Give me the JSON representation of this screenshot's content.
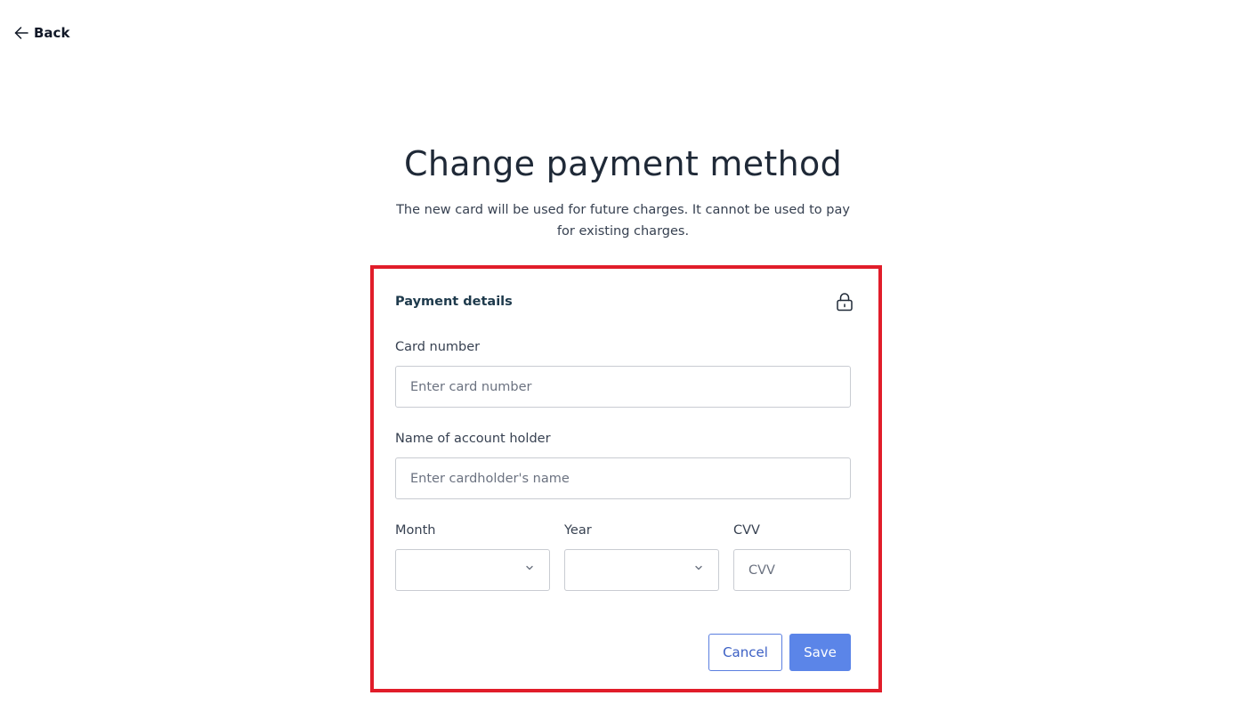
{
  "nav": {
    "back_label": "Back",
    "back_icon": "arrow-left-icon"
  },
  "header": {
    "title": "Change payment method",
    "subtitle": "The new card will be used for future charges. It cannot be used to pay for existing charges."
  },
  "payment_form": {
    "title": "Payment details",
    "lock_icon": "lock-icon",
    "card_number": {
      "label": "Card number",
      "value": "",
      "placeholder": "Enter card number"
    },
    "account_holder": {
      "label": "Name of account holder",
      "value": "",
      "placeholder": "Enter cardholder's name"
    },
    "month": {
      "label": "Month",
      "selected": ""
    },
    "year": {
      "label": "Year",
      "selected": ""
    },
    "cvv": {
      "label": "CVV",
      "value": "",
      "placeholder": "CVV"
    },
    "cancel_label": "Cancel",
    "save_label": "Save"
  },
  "colors": {
    "highlight_border": "#e11d2a",
    "primary": "#5b85e8",
    "cancel_border": "#5b7fe0"
  }
}
